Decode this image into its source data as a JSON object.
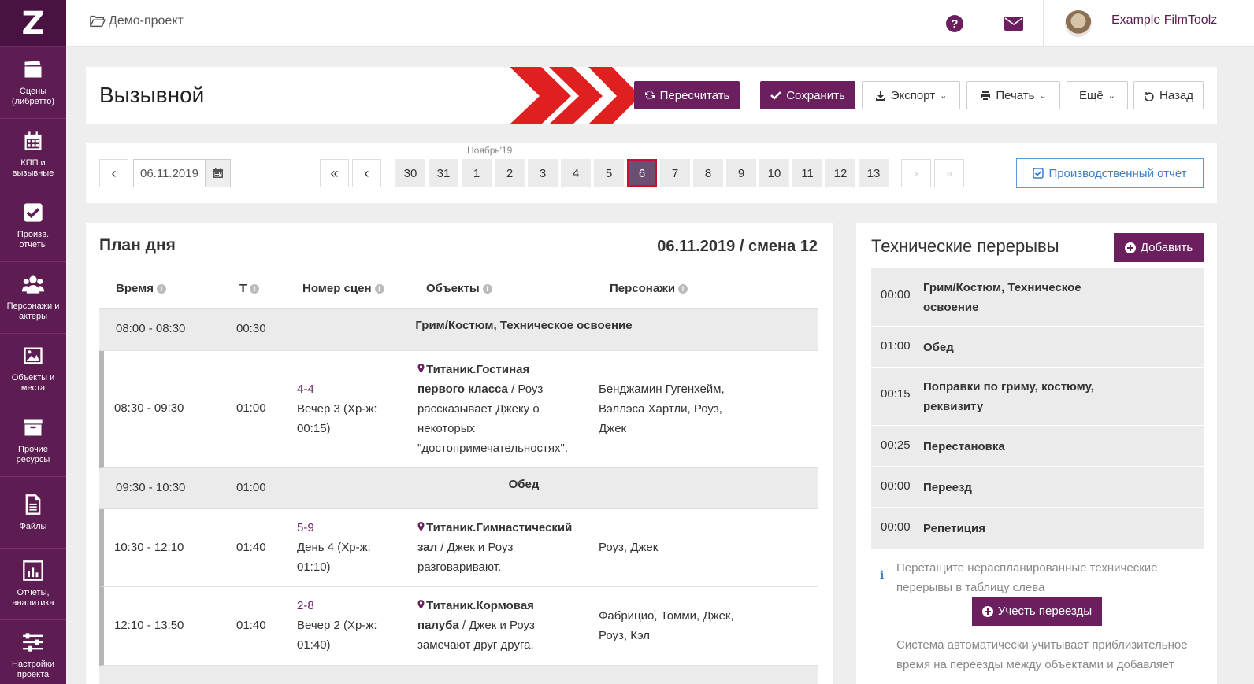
{
  "sidebar": {
    "logo": "Z",
    "items": [
      {
        "label": "Сцены (либретто)",
        "icon": "clapperboard-icon"
      },
      {
        "label": "КПП и вызывные",
        "icon": "calendar-icon"
      },
      {
        "label": "Произв. отчеты",
        "icon": "checkbox-icon"
      },
      {
        "label": "Персонажи и актеры",
        "icon": "users-icon"
      },
      {
        "label": "Объекты и места",
        "icon": "image-icon"
      },
      {
        "label": "Прочие ресурсы",
        "icon": "archive-icon"
      },
      {
        "label": "Файлы",
        "icon": "file-icon"
      },
      {
        "label": "Отчеты, аналитика",
        "icon": "bar-chart-icon"
      },
      {
        "label": "Настройки проекта",
        "icon": "sliders-icon"
      }
    ]
  },
  "topbar": {
    "project": "Демо-проект",
    "username": "Example FilmToolz"
  },
  "header": {
    "title": "Вызывной",
    "recalc": "Пересчитать",
    "save": "Сохранить",
    "export": "Экспорт",
    "print": "Печать",
    "more": "Ещё",
    "back": "Назад"
  },
  "datebar": {
    "prev": "‹",
    "date": "06.11.2019",
    "first": "«",
    "prev_day": "‹",
    "month": "Ноябрь'19",
    "days": [
      "30",
      "31",
      "1",
      "2",
      "3",
      "4",
      "5",
      "6",
      "7",
      "8",
      "9",
      "10",
      "11",
      "12",
      "13"
    ],
    "active_day": "6",
    "next_day": "›",
    "last": "»",
    "report": "Производственный отчет"
  },
  "plan": {
    "title": "План дня",
    "date_shift": "06.11.2019 / смена 12",
    "columns": [
      "Время",
      "Т",
      "Номер сцен",
      "Объекты",
      "Персонажи"
    ],
    "rows": [
      {
        "type": "break",
        "time": "08:00 - 08:30",
        "dur": "00:30",
        "name": "Грим/Костюм, Техническое освоение"
      },
      {
        "type": "scene",
        "time": "08:30 - 09:30",
        "dur": "01:00",
        "scene": "4-4",
        "scene_desc": "Вечер 3 (Хр-ж: 00:15)",
        "object": "Титаник.Гостиная первого класса",
        "desc": " / Роуз рассказывает Джеку о некоторых \"достопримечательностях\".",
        "characters": "Бенджамин Гугенхейм, Вэллэса Хартли, Роуз, Джек"
      },
      {
        "type": "break",
        "time": "09:30 - 10:30",
        "dur": "01:00",
        "name": "Обед"
      },
      {
        "type": "scene",
        "time": "10:30 - 12:10",
        "dur": "01:40",
        "scene": "5-9",
        "scene_desc": "День 4 (Хр-ж: 01:10)",
        "object": "Титаник.Гимнастический зал",
        "desc": " / Джек и Роуз разговаривают.",
        "characters": "Роуз, Джек"
      },
      {
        "type": "scene",
        "time": "12:10 - 13:50",
        "dur": "01:40",
        "scene": "2-8",
        "scene_desc": "Вечер 2 (Хр-ж: 01:40)",
        "object": "Титаник.Кормовая палуба",
        "desc": " / Джек и Роуз замечают друг друга.",
        "characters": "Фабрицио, Томми, Джек, Роуз, Кэл"
      }
    ]
  },
  "tech": {
    "title": "Технические перерывы",
    "add": "Добавить",
    "breaks": [
      {
        "dur": "00:00",
        "name": "Грим/Костюм, Техническое освоение"
      },
      {
        "dur": "01:00",
        "name": "Обед"
      },
      {
        "dur": "00:15",
        "name": "Поправки по гриму, костюму, реквизиту"
      },
      {
        "dur": "00:25",
        "name": "Перестановка"
      },
      {
        "dur": "00:00",
        "name": "Переезд"
      },
      {
        "dur": "00:00",
        "name": "Репетиция"
      }
    ],
    "hint": "Перетащите нераспланированные технические перерывы в таблицу слева",
    "moves_btn": "Учесть переезды",
    "hint2": "Система автоматически учитывает приблизительное время на переезды между объектами и добавляет"
  },
  "colors": {
    "brand": "#5e1d52",
    "button": "#6b1f5f",
    "accent_red": "#e02020",
    "link_blue": "#3a7dc9"
  }
}
